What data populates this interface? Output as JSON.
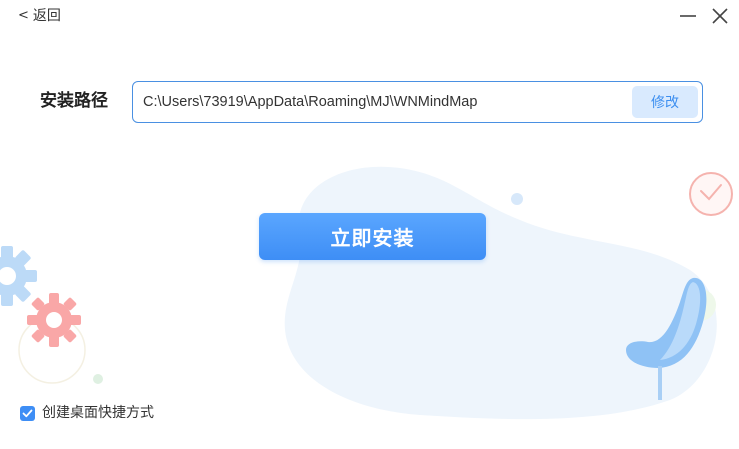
{
  "titlebar": {
    "back_label": "返回"
  },
  "install": {
    "path_label": "安装路径",
    "path_value": "C:\\Users\\73919\\AppData\\Roaming\\MJ\\WNMindMap",
    "modify_label": "修改",
    "install_button_label": "立即安装"
  },
  "options": {
    "create_shortcut_label": "创建桌面快捷方式",
    "create_shortcut_checked": true
  },
  "colors": {
    "accent": "#3e8ef5",
    "modify_bg": "#d9eafe",
    "decor_blob": "#eef5fc",
    "gear_red": "#f9a7a7",
    "gear_blue": "#bcdaf7"
  }
}
